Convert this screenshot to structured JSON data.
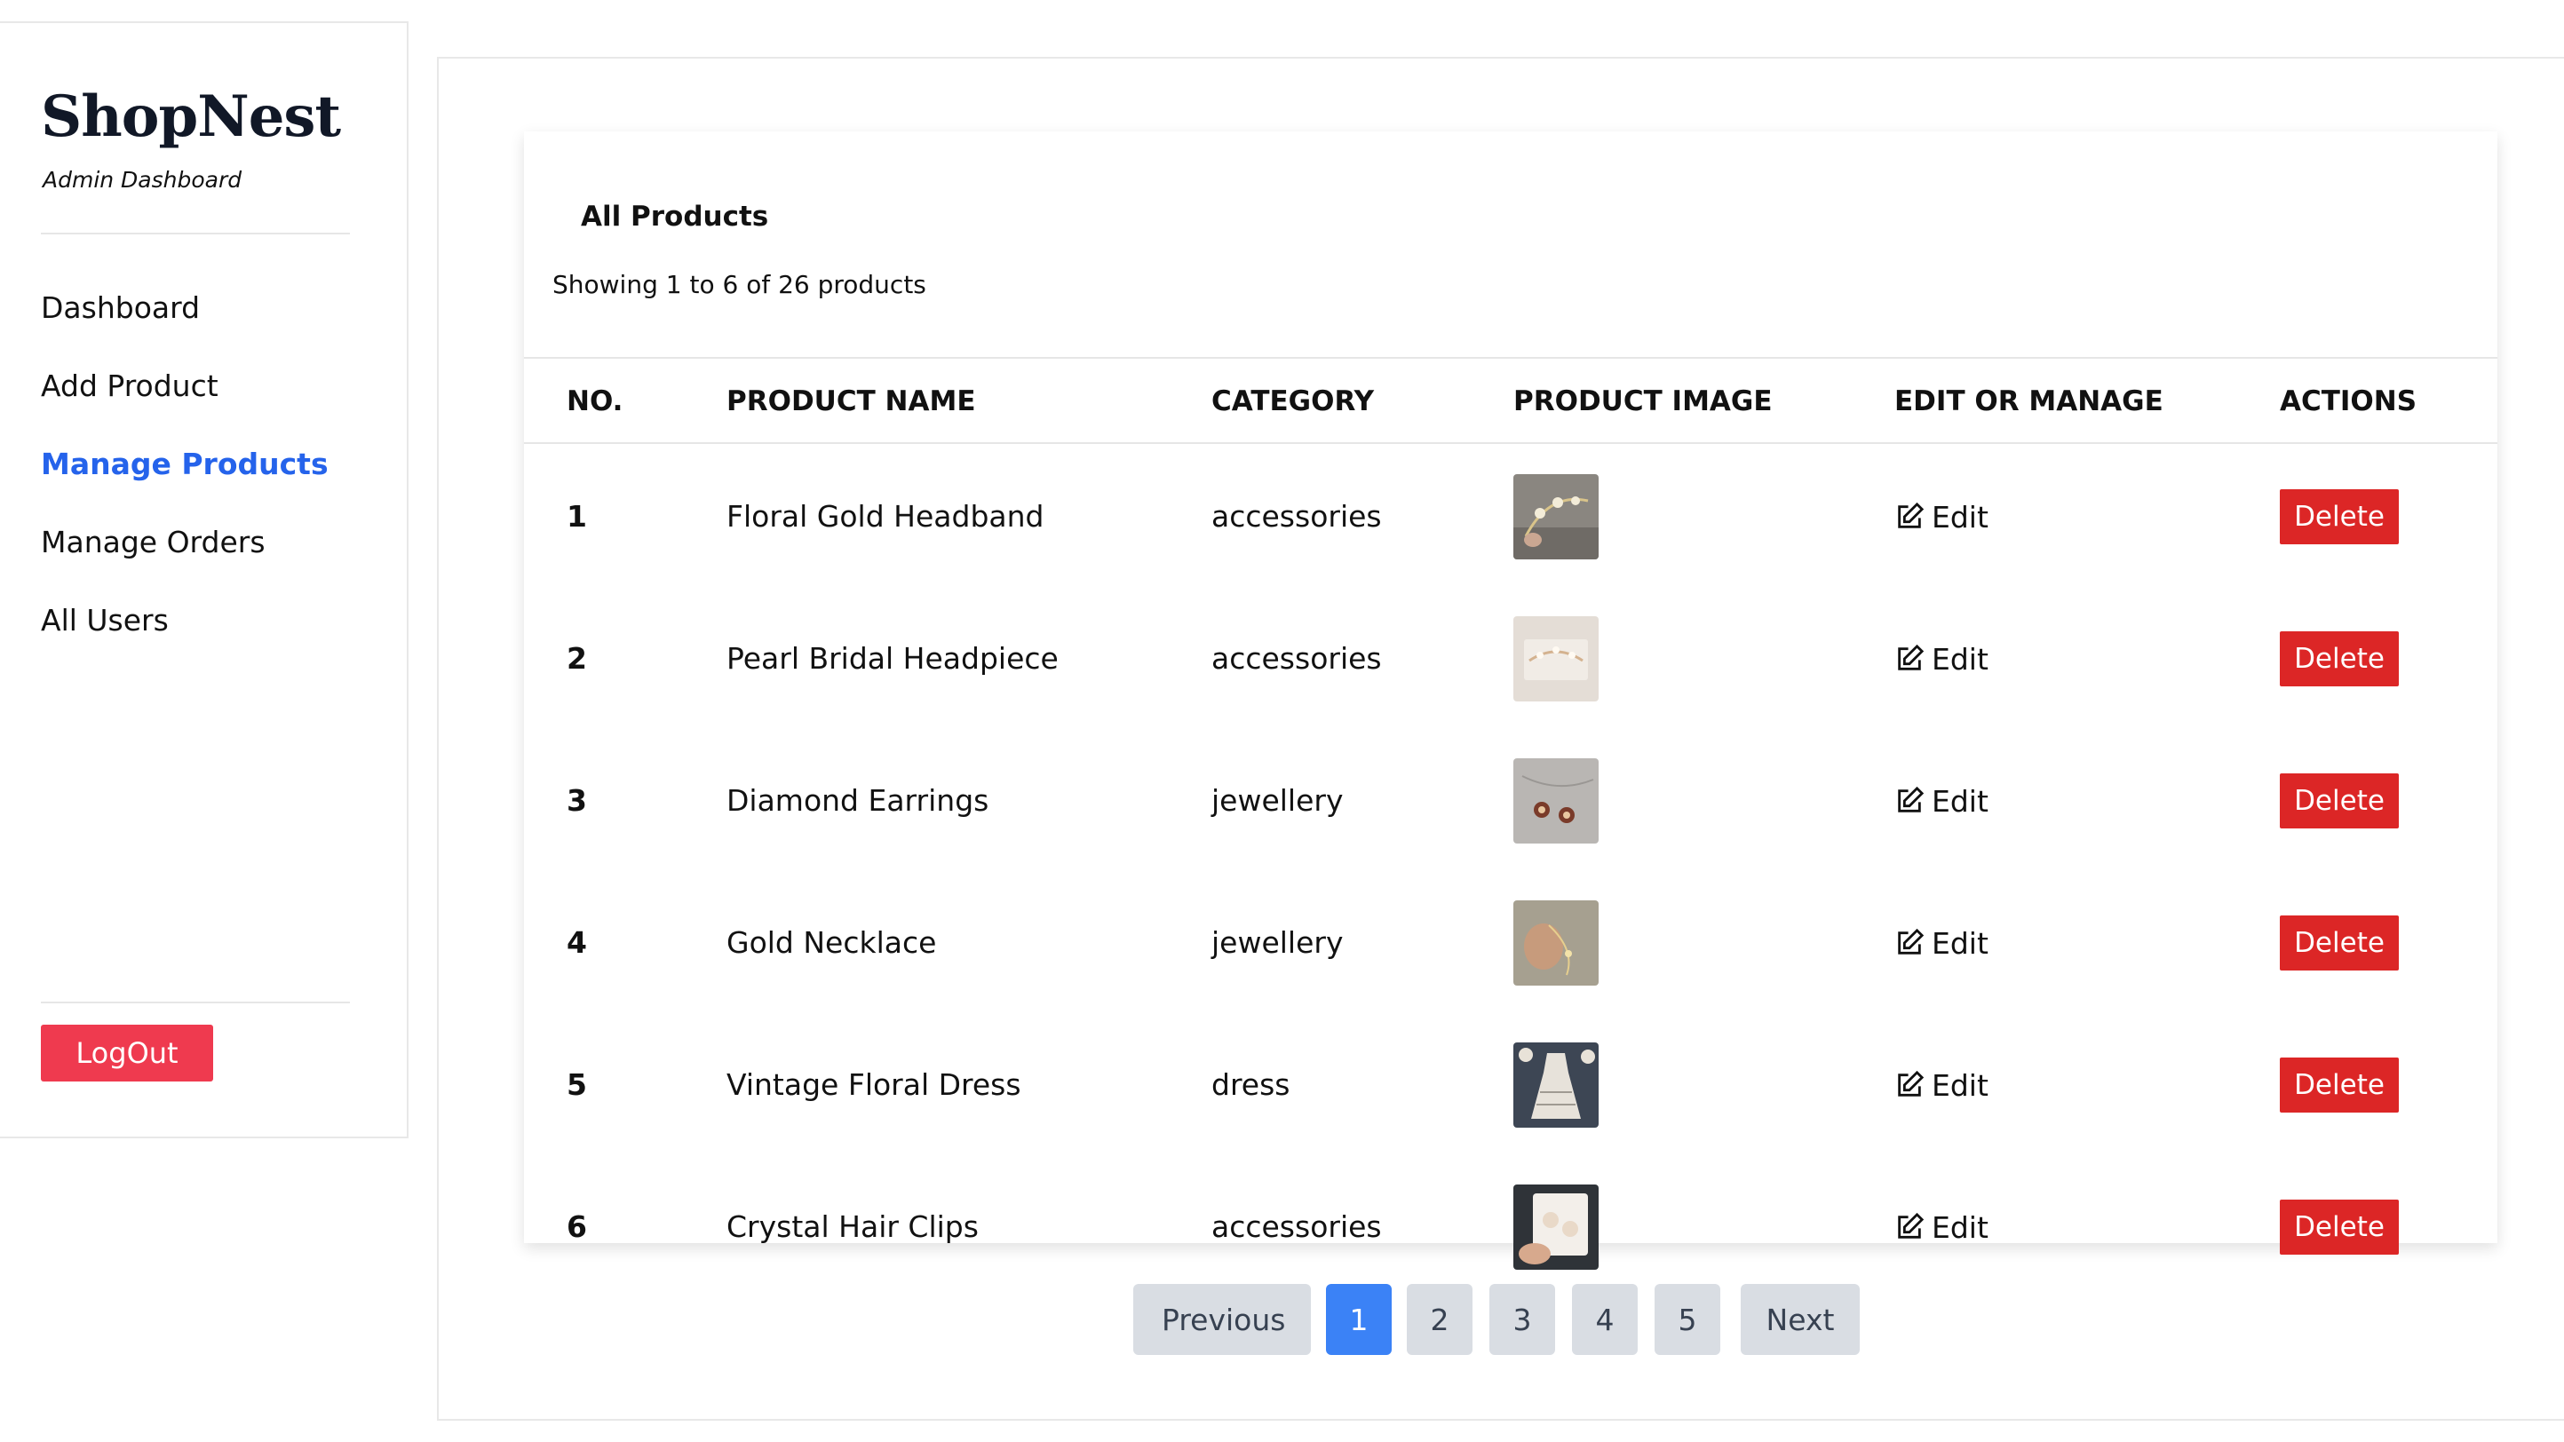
{
  "sidebar": {
    "brand": "ShopNest",
    "subtitle": "Admin Dashboard",
    "nav": [
      {
        "label": "Dashboard",
        "active": false
      },
      {
        "label": "Add Product",
        "active": false
      },
      {
        "label": "Manage Products",
        "active": true
      },
      {
        "label": "Manage Orders",
        "active": false
      },
      {
        "label": "All Users",
        "active": false
      }
    ],
    "logout_label": "LogOut"
  },
  "products": {
    "title": "All Products",
    "summary": "Showing 1 to 6 of 26 products",
    "columns": [
      "NO.",
      "PRODUCT NAME",
      "CATEGORY",
      "PRODUCT IMAGE",
      "EDIT OR MANAGE",
      "ACTIONS"
    ],
    "rows": [
      {
        "no": "1",
        "name": "Floral Gold Headband",
        "category": "accessories",
        "image": "headband-photo"
      },
      {
        "no": "2",
        "name": "Pearl Bridal Headpiece",
        "category": "accessories",
        "image": "headpiece-photo"
      },
      {
        "no": "3",
        "name": "Diamond Earrings",
        "category": "jewellery",
        "image": "earrings-photo"
      },
      {
        "no": "4",
        "name": "Gold Necklace",
        "category": "jewellery",
        "image": "necklace-photo"
      },
      {
        "no": "5",
        "name": "Vintage Floral Dress",
        "category": "dress",
        "image": "dress-photo"
      },
      {
        "no": "6",
        "name": "Crystal Hair Clips",
        "category": "accessories",
        "image": "hair-clips-photo"
      }
    ],
    "edit_label": "Edit",
    "edit_icon": "edit-icon",
    "delete_label": "Delete"
  },
  "pagination": {
    "previous_label": "Previous",
    "pages": [
      "1",
      "2",
      "3",
      "4",
      "5"
    ],
    "current_page": "1",
    "next_label": "Next"
  },
  "colors": {
    "accent": "#2563eb",
    "page_active": "#3b82f6",
    "delete": "#dc2626",
    "logout": "#ef3a4f",
    "pager_bg": "#d9dde3"
  }
}
